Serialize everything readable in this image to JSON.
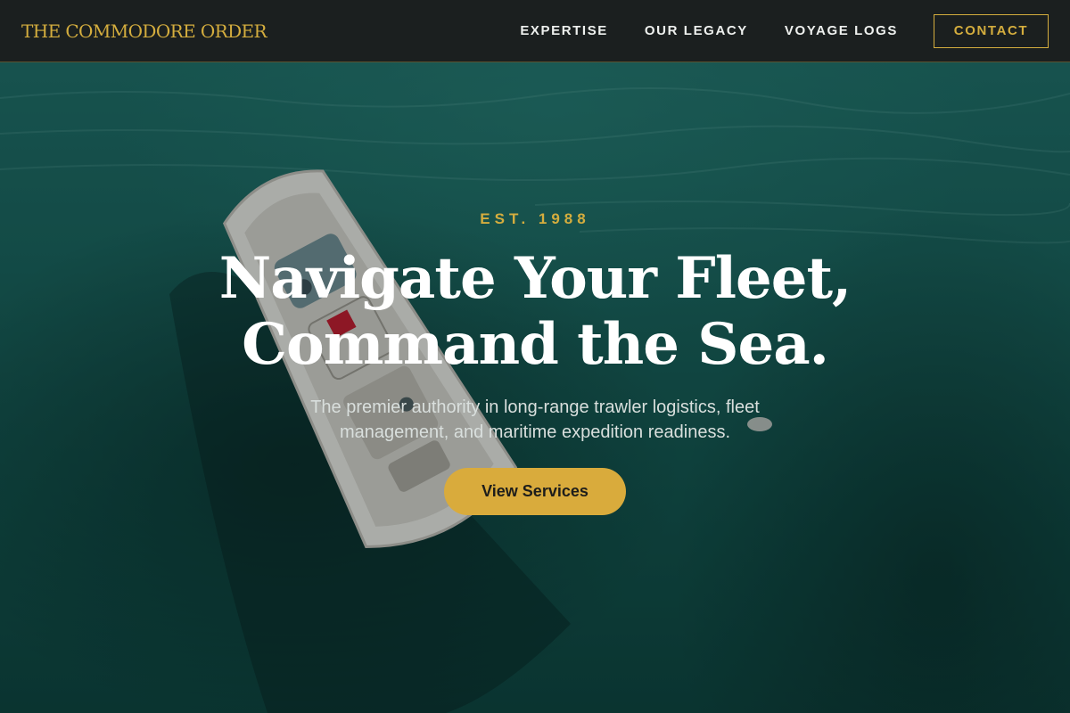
{
  "brand": {
    "name": "THE COMMODORE ORDER",
    "color": "#d4ad3e"
  },
  "nav": {
    "links": [
      {
        "label": "EXPERTISE"
      },
      {
        "label": "OUR LEGACY"
      },
      {
        "label": "VOYAGE LOGS"
      }
    ],
    "contact_label": "CONTACT"
  },
  "hero": {
    "eyebrow": "EST. 1988",
    "headline_line1": "Navigate Your Fleet,",
    "headline_line2": "Command the Sea.",
    "subtext": "The premier authority in long-range trawler logistics, fleet management, and maritime expedition readiness.",
    "cta_label": "View Services",
    "background_image": "aerial-boat-on-sea"
  },
  "colors": {
    "accent_gold": "#d4ad3e",
    "nav_background": "#1b1f1f",
    "sea_teal": "#17605a"
  }
}
